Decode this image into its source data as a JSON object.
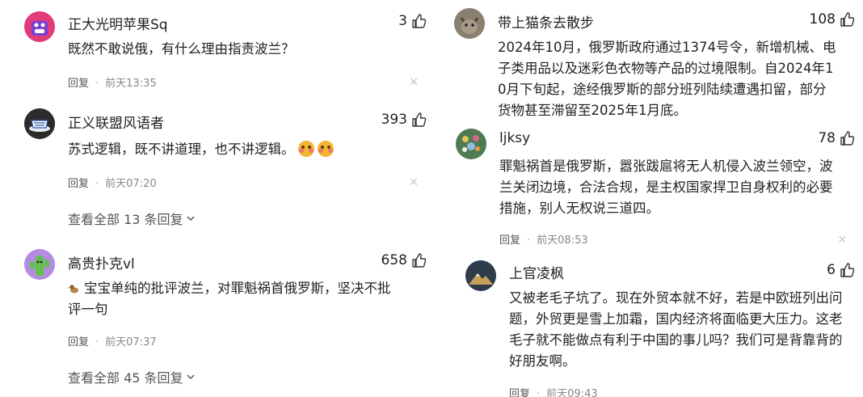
{
  "left": {
    "comments": [
      {
        "name": "正大光明苹果Sq",
        "likes": "3",
        "lines": [
          "既然不敢说俄，有什么理由指责波兰？"
        ],
        "reply": "回复",
        "time": "前天13:35"
      },
      {
        "name": "正义联盟风语者",
        "likes": "393",
        "lines": [
          "苏式逻辑，既不讲道理，也不讲逻辑。"
        ],
        "reply": "回复",
        "time": "前天07:20",
        "view_all": "查看全部 13 条回复"
      },
      {
        "name": "高贵扑克vl",
        "likes": "658",
        "lines": [
          "宝宝单纯的批评波兰，对罪魁祸首俄罗斯，坚决不批",
          "评一句"
        ],
        "reply": "回复",
        "time": "前天07:37",
        "view_all": "查看全部 45 条回复"
      }
    ]
  },
  "right": {
    "comments": [
      {
        "name": "带上猫条去散步",
        "likes": "108",
        "lines": [
          "2024年10月，俄罗斯政府通过1374号令，新增机械、电",
          "子类用品以及迷彩色衣物等产品的过境限制。自2024年1",
          "0月下旬起，途经俄罗斯的部分班列陆续遭遇扣留，部分",
          "货物甚至滞留至2025年1月底。"
        ]
      },
      {
        "name": "ljksy",
        "likes": "78",
        "lines": [
          "罪魁祸首是俄罗斯，嚣张跋扈将无人机侵入波兰领空，波",
          "兰关闭边境，合法合规，是主权国家捍卫自身权利的必要",
          "措施，别人无权说三道四。"
        ],
        "reply": "回复",
        "time": "前天08:53"
      },
      {
        "name": "上官凌枫",
        "likes": "6",
        "lines": [
          "又被老毛子坑了。现在外贸本就不好，若是中欧班列出问",
          "题，外贸更是雪上加霜，国内经济将面临更大压力。这老",
          "毛子就不能做点有利于中国的事儿吗？我们可是背靠背的",
          "好朋友啊。"
        ],
        "reply": "回复",
        "time": "前天09:43"
      }
    ]
  },
  "icons": {
    "thumb": "thumbs-up-icon",
    "close": "close-icon",
    "chevron": "chevron-down-icon",
    "emoji": "smiley-emoji-icon",
    "duck": "duck-emoji-icon"
  },
  "colors": {
    "text": "#222222",
    "meta": "#888888",
    "close": "#c8c8c8"
  }
}
